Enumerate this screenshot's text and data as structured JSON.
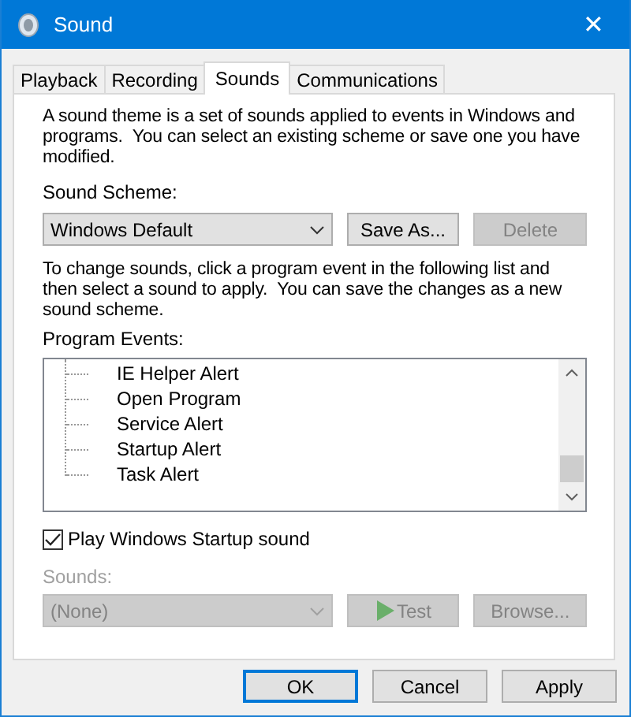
{
  "window": {
    "title": "Sound",
    "close": "✕"
  },
  "tabs": [
    {
      "label": "Playback",
      "selected": false
    },
    {
      "label": "Recording",
      "selected": false
    },
    {
      "label": "Sounds",
      "selected": true
    },
    {
      "label": "Communications",
      "selected": false
    }
  ],
  "intro": "A sound theme is a set of sounds applied to events in Windows and programs.  You can select an existing scheme or save one you have modified.",
  "scheme": {
    "label": "Sound Scheme:",
    "value": "Windows Default",
    "disabled": false,
    "buttons": [
      {
        "label": "Save As...",
        "disabled": false
      },
      {
        "label": "Delete",
        "disabled": true
      }
    ]
  },
  "instructions": "To change sounds, click a program event in the following list and then select a sound to apply.  You can save the changes as a new sound scheme.",
  "events": {
    "label": "Program Events:",
    "items": [
      {
        "label": "IE Helper Alert",
        "selected": false
      },
      {
        "label": "Open Program",
        "selected": false
      },
      {
        "label": "Service Alert",
        "selected": false
      },
      {
        "label": "Startup Alert",
        "selected": false
      },
      {
        "label": "Task Alert",
        "selected": false
      }
    ]
  },
  "startup_checkbox": {
    "label": "Play Windows Startup sound",
    "checked": true
  },
  "sounds": {
    "label": "Sounds:",
    "value": "(None)",
    "disabled": true,
    "buttons": [
      {
        "label": "Test",
        "kind": "play",
        "disabled": true
      },
      {
        "label": "Browse...",
        "kind": "plain",
        "disabled": true
      }
    ]
  },
  "dialog_buttons": [
    {
      "label": "OK",
      "default": true
    },
    {
      "label": "Cancel",
      "default": false
    },
    {
      "label": "Apply",
      "default": false
    }
  ]
}
